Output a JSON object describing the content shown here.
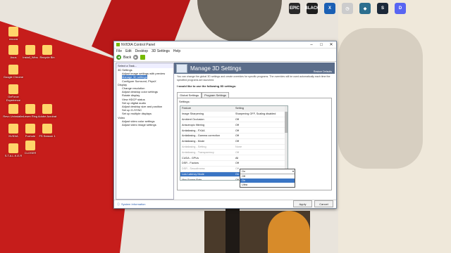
{
  "desktop": {
    "icons": [
      {
        "label": "recuva"
      },
      {
        "label": "Asus"
      },
      {
        "label": "Google Chrome"
      },
      {
        "label": "GeForce Experience"
      },
      {
        "label": "Revo Uninstaller"
      },
      {
        "label": "NVIDIA"
      },
      {
        "label": "Install_Wins"
      },
      {
        "label": "Recycle Bin"
      },
      {
        "label": "Lesen Ring"
      },
      {
        "label": "Adobe Acrobat"
      },
      {
        "label": "FS Season 1"
      },
      {
        "label": "Foxhole"
      },
      {
        "label": "CLOSER"
      },
      {
        "label": "S.T.A.L.K.E.R"
      }
    ],
    "top_icons": [
      {
        "name": "epic-icon",
        "label": "EPIC",
        "color": "#2a2a2a"
      },
      {
        "name": "black-flag-icon",
        "label": "BLACK",
        "color": "#1e1e1e"
      },
      {
        "name": "xbox-icon",
        "label": "X",
        "color": "#1a5fb4"
      },
      {
        "name": "clock-icon",
        "label": "◷",
        "color": "#cccccc"
      },
      {
        "name": "game-icon",
        "label": "◆",
        "color": "#2c6e8e"
      },
      {
        "name": "steam-icon",
        "label": "S",
        "color": "#1b2838"
      },
      {
        "name": "discord-icon",
        "label": "D",
        "color": "#5865f2"
      }
    ]
  },
  "window": {
    "title": "NVIDIA Control Panel",
    "menu": [
      "File",
      "Edit",
      "Desktop",
      "3D Settings",
      "Help"
    ],
    "toolbar_back": "Back",
    "left_panel": {
      "header": "Select a Task...",
      "items": [
        {
          "text": "3D Settings",
          "indent": 0
        },
        {
          "text": "Adjust image settings with preview",
          "indent": 1
        },
        {
          "text": "Manage 3D settings",
          "indent": 1,
          "selected": true
        },
        {
          "text": "Configure Surround, PhysX",
          "indent": 1
        },
        {
          "text": "Display",
          "indent": 0
        },
        {
          "text": "Change resolution",
          "indent": 1
        },
        {
          "text": "Adjust desktop color settings",
          "indent": 1
        },
        {
          "text": "Rotate display",
          "indent": 1
        },
        {
          "text": "View HDCP status",
          "indent": 1
        },
        {
          "text": "Set up digital audio",
          "indent": 1
        },
        {
          "text": "Adjust desktop size and position",
          "indent": 1
        },
        {
          "text": "Set up G-SYNC",
          "indent": 1
        },
        {
          "text": "Set up multiple displays",
          "indent": 1
        },
        {
          "text": "Video",
          "indent": 0
        },
        {
          "text": "Adjust video color settings",
          "indent": 1
        },
        {
          "text": "Adjust video image settings",
          "indent": 1
        }
      ]
    },
    "banner": {
      "title": "Manage 3D Settings",
      "restore": "Restore Defaults"
    },
    "description": "You can change the global 3D settings and create overrides for specific programs. The overrides will be used automatically each time the specified programs are launched.",
    "i_would_like": "I would like to use the following 3D settings:",
    "tabs": [
      "Global Settings",
      "Program Settings"
    ],
    "settings_label": "Settings:",
    "grid": {
      "header": [
        "Feature",
        "Setting"
      ],
      "rows": [
        {
          "feature": "Image Sharpening",
          "setting": "Sharpening OFF, Scaling disabled"
        },
        {
          "feature": "Ambient Occlusion",
          "setting": "Off"
        },
        {
          "feature": "Anisotropic filtering",
          "setting": "Off"
        },
        {
          "feature": "Antialiasing - FXAA",
          "setting": "Off"
        },
        {
          "feature": "Antialiasing - Gamma correction",
          "setting": "Off"
        },
        {
          "feature": "Antialiasing - Mode",
          "setting": "Off"
        },
        {
          "feature": "Antialiasing - Setting",
          "setting": "None",
          "dim": true
        },
        {
          "feature": "Antialiasing - Transparency",
          "setting": "Off",
          "dim": true
        },
        {
          "feature": "CUDA - GPUs",
          "setting": "All"
        },
        {
          "feature": "DSR - Factors",
          "setting": "Off"
        },
        {
          "feature": "DSR - Smoothness",
          "setting": "Off",
          "dim": true
        },
        {
          "feature": "Low Latency Mode",
          "setting": "On",
          "selected": true
        },
        {
          "feature": "Max Frame Rate",
          "setting": "Off"
        }
      ]
    },
    "dropdown": {
      "current": "On",
      "options": [
        "Off",
        "On",
        "Ultra"
      ],
      "highlighted": 1
    },
    "footer": {
      "system_info": "System Information",
      "apply": "Apply",
      "cancel": "Cancel"
    }
  }
}
